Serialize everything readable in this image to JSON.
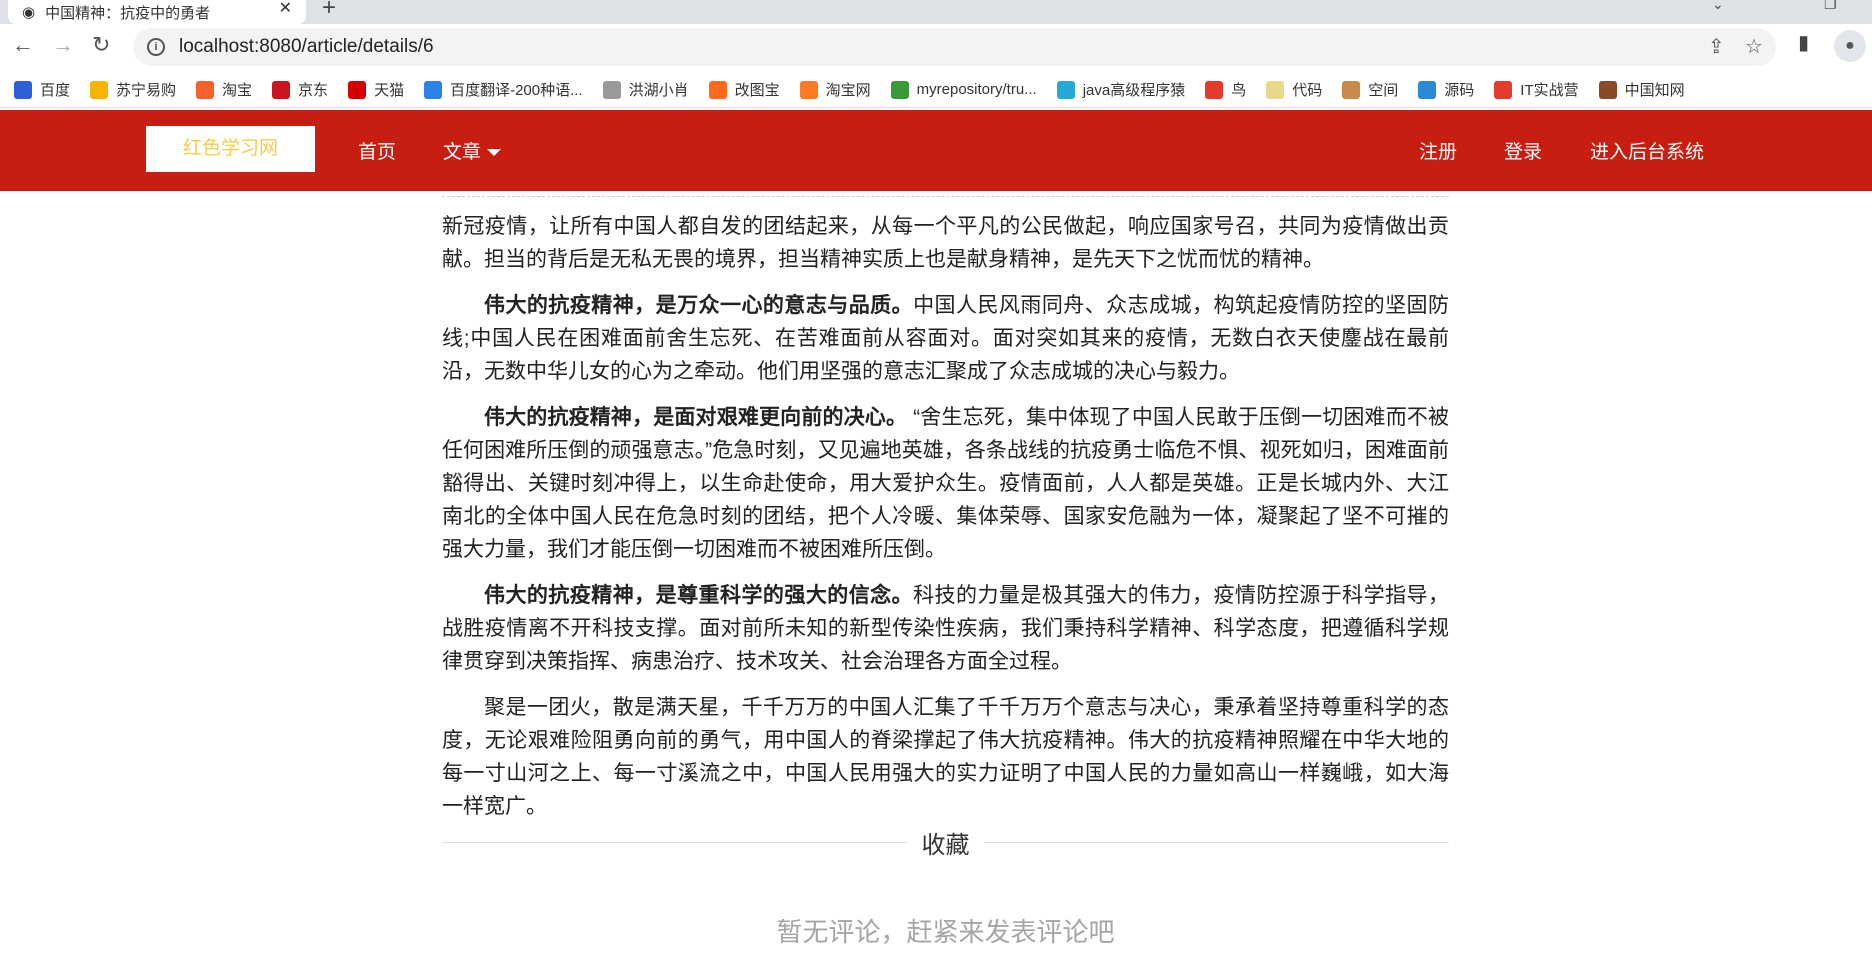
{
  "browser": {
    "tab_title": "中国精神：抗疫中的勇者",
    "url": "localhost:8080/article/details/6",
    "bookmarks": [
      {
        "label": "百度",
        "color": "#2f5fd8"
      },
      {
        "label": "苏宁易购",
        "color": "#f5b400"
      },
      {
        "label": "淘宝",
        "color": "#f5622d"
      },
      {
        "label": "京东",
        "color": "#c9151e"
      },
      {
        "label": "天猫",
        "color": "#d40000"
      },
      {
        "label": "百度翻译-200种语...",
        "color": "#2b82e8"
      },
      {
        "label": "洪湖小肖",
        "color": "#999999"
      },
      {
        "label": "改图宝",
        "color": "#ff6a1f"
      },
      {
        "label": "淘宝网",
        "color": "#ff7a22"
      },
      {
        "label": "myrepository/tru...",
        "color": "#3a9a3a"
      },
      {
        "label": "java高级程序猿",
        "color": "#23a8d8"
      },
      {
        "label": "鸟",
        "color": "#e53b2c"
      },
      {
        "label": "代码",
        "color": "#e8d98a"
      },
      {
        "label": "空间",
        "color": "#c88a4a"
      },
      {
        "label": "源码",
        "color": "#2b8ad8"
      },
      {
        "label": "IT实战营",
        "color": "#e53b2c"
      },
      {
        "label": "中国知网",
        "color": "#8a4a2a"
      }
    ]
  },
  "navbar": {
    "brand": "红色学习网",
    "home": "首页",
    "articles": "文章",
    "register": "注册",
    "login": "登录",
    "admin": "进入后台系统",
    "bg_color": "#c81e12",
    "brand_color": "#f7cc45"
  },
  "article": {
    "p1": "新冠疫情，让所有中国人都自发的团结起来，从每一个平凡的公民做起，响应国家号召，共同为疫情做出贡献。担当的背后是无私无畏的境界，担当精神实质上也是献身精神，是先天下之忧而忧的精神。",
    "p2_bold": "伟大的抗疫精神，是万众一心的意志与品质。",
    "p2": "中国人民风雨同舟、众志成城，构筑起疫情防控的坚固防线;中国人民在困难面前舍生忘死、在苦难面前从容面对。面对突如其来的疫情，无数白衣天使鏖战在最前沿，无数中华儿女的心为之牵动。他们用坚强的意志汇聚成了众志成城的决心与毅力。",
    "p3_bold": "伟大的抗疫精神，是面对艰难更向前的决心。",
    "p3": " “舍生忘死，集中体现了中国人民敢于压倒一切困难而不被任何困难所压倒的顽强意志。”危急时刻，又见遍地英雄，各条战线的抗疫勇士临危不惧、视死如归，困难面前豁得出、关键时刻冲得上，以生命赴使命，用大爱护众生。疫情面前，人人都是英雄。正是长城内外、大江南北的全体中国人民在危急时刻的团结，把个人冷暖、集体荣辱、国家安危融为一体，凝聚起了坚不可摧的强大力量，我们才能压倒一切困难而不被困难所压倒。",
    "p4_bold": "伟大的抗疫精神，是尊重科学的强大的信念。",
    "p4": "科技的力量是极其强大的伟力，疫情防控源于科学指导，战胜疫情离不开科技支撑。面对前所未知的新型传染性疾病，我们秉持科学精神、科学态度，把遵循科学规律贯穿到决策指挥、病患治疗、技术攻关、社会治理各方面全过程。",
    "p5": "聚是一团火，散是满天星，千千万万的中国人汇集了千千万万个意志与决心，秉承着坚持尊重科学的态度，无论艰难险阻勇向前的勇气，用中国人的脊梁撑起了伟大抗疫精神。伟大的抗疫精神照耀在中华大地的每一寸山河之上、每一寸溪流之中，中国人民用强大的实力证明了中国人民的力量如高山一样巍峨，如大海一样宽广。"
  },
  "favorite_label": "收藏",
  "comments_empty": "暂无评论，赶紧来发表评论吧"
}
